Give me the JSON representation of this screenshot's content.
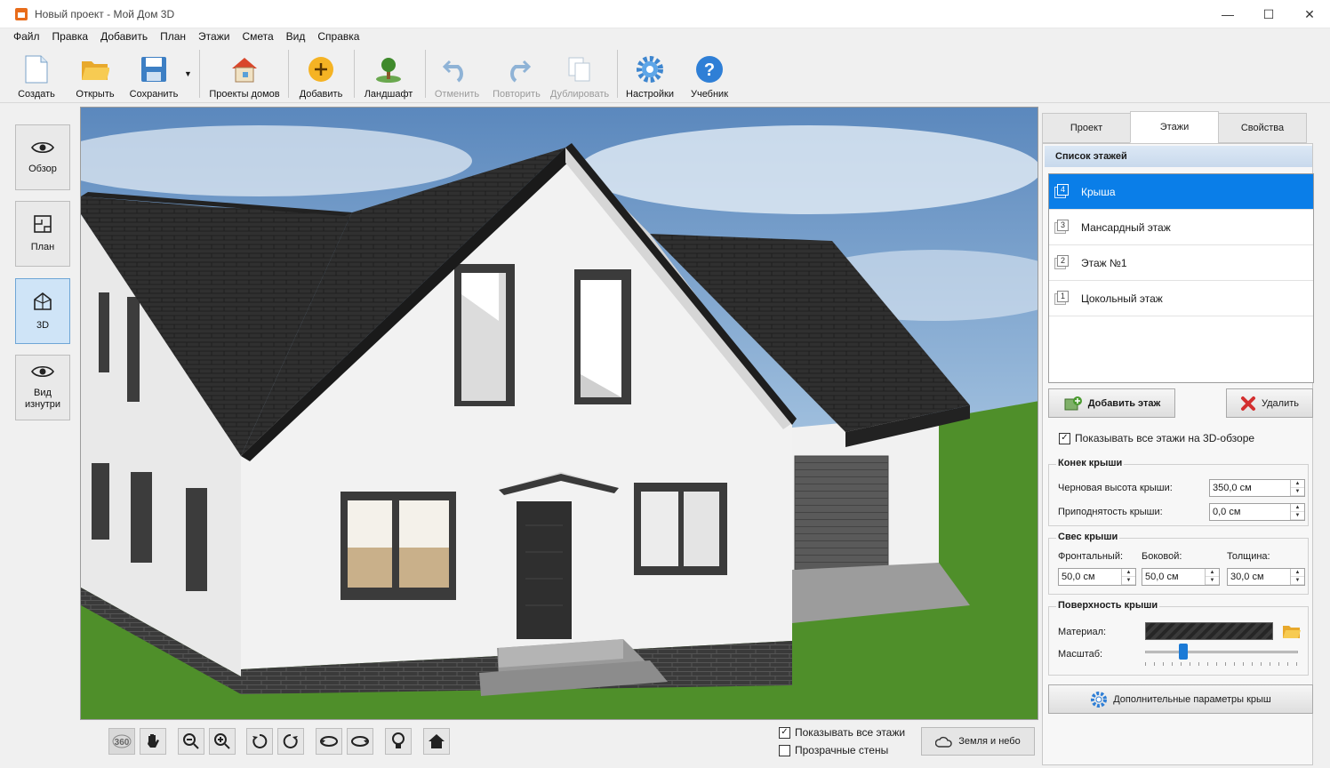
{
  "window": {
    "title": "Новый проект - Мой Дом 3D",
    "minimize": "—",
    "maximize": "☐",
    "close": "✕"
  },
  "menu": [
    "Файл",
    "Правка",
    "Добавить",
    "План",
    "Этажи",
    "Смета",
    "Вид",
    "Справка"
  ],
  "toolbar": {
    "create": "Создать",
    "open": "Открыть",
    "save": "Сохранить",
    "save_dropdown": "▼",
    "projects": "Проекты домов",
    "add": "Добавить",
    "landscape": "Ландшафт",
    "undo": "Отменить",
    "redo": "Повторить",
    "duplicate": "Дублировать",
    "settings": "Настройки",
    "tutorial": "Учебник"
  },
  "views": {
    "overview": "Обзор",
    "plan": "План",
    "three_d": "3D",
    "inside": "Вид изнутри"
  },
  "scene_options": {
    "show_all_floors": "Показывать все этажи",
    "show_all_floors_checked": true,
    "transparent_walls": "Прозрачные стены",
    "transparent_walls_checked": false,
    "ground_sky": "Земля и небо"
  },
  "tabs": [
    "Проект",
    "Этажи",
    "Свойства"
  ],
  "active_tab": "Этажи",
  "floors_panel": {
    "header": "Список этажей",
    "floors": [
      {
        "num": "4",
        "name": "Крыша",
        "selected": true
      },
      {
        "num": "3",
        "name": "Мансардный этаж",
        "selected": false
      },
      {
        "num": "2",
        "name": "Этаж №1",
        "selected": false
      },
      {
        "num": "1",
        "name": "Цокольный этаж",
        "selected": false
      }
    ],
    "add_floor": "Добавить этаж",
    "delete": "Удалить",
    "show_all_3d": "Показывать все этажи на 3D-обзоре",
    "show_all_3d_checked": true
  },
  "roof_ridge": {
    "title": "Конек крыши",
    "rough_height_label": "Черновая высота крыши:",
    "rough_height_value": "350,0 см",
    "rise_label": "Приподнятость крыши:",
    "rise_value": "0,0 см"
  },
  "roof_overhang": {
    "title": "Свес крыши",
    "front_label": "Фронтальный:",
    "front_value": "50,0 см",
    "side_label": "Боковой:",
    "side_value": "50,0 см",
    "thickness_label": "Толщина:",
    "thickness_value": "30,0 см"
  },
  "roof_surface": {
    "title": "Поверхность крыши",
    "material_label": "Материал:",
    "scale_label": "Масштаб:",
    "scale_level": 0.25
  },
  "more_params": "Дополнительные параметры крыш",
  "colors": {
    "accent": "#0a7ee8",
    "roof": "#2e2e2e",
    "wall": "#f2f2f2",
    "grass": "#4f8f2a"
  }
}
